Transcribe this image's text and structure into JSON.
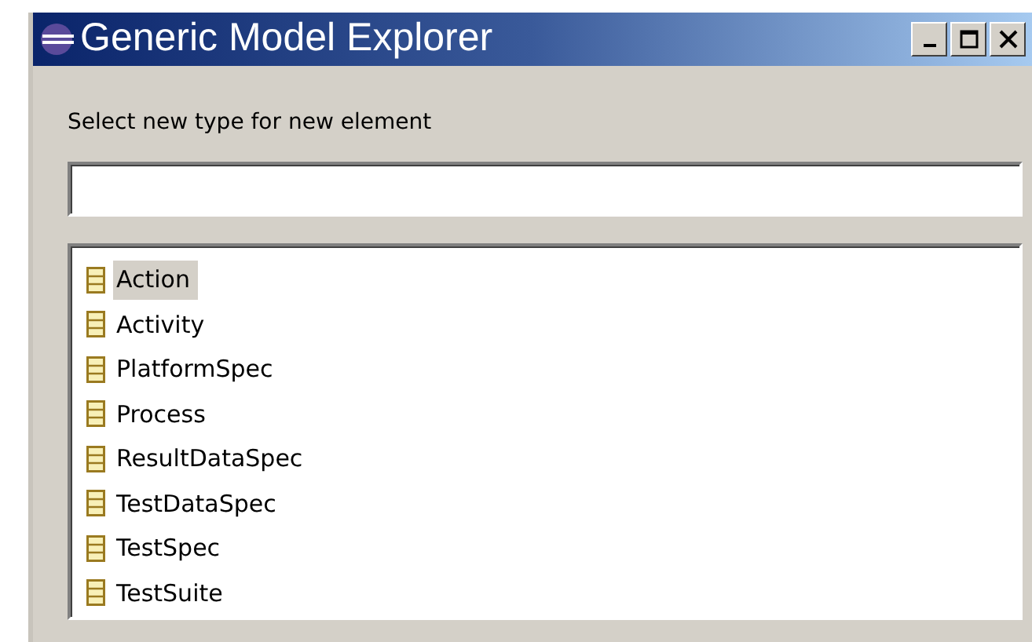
{
  "window": {
    "title": "Generic Model Explorer"
  },
  "prompt": "Select new type for new element",
  "types": [
    {
      "label": "Action",
      "selected": true
    },
    {
      "label": "Activity",
      "selected": false
    },
    {
      "label": "PlatformSpec",
      "selected": false
    },
    {
      "label": "Process",
      "selected": false
    },
    {
      "label": "ResultDataSpec",
      "selected": false
    },
    {
      "label": "TestDataSpec",
      "selected": false
    },
    {
      "label": "TestSpec",
      "selected": false
    },
    {
      "label": "TestSuite",
      "selected": false
    }
  ]
}
